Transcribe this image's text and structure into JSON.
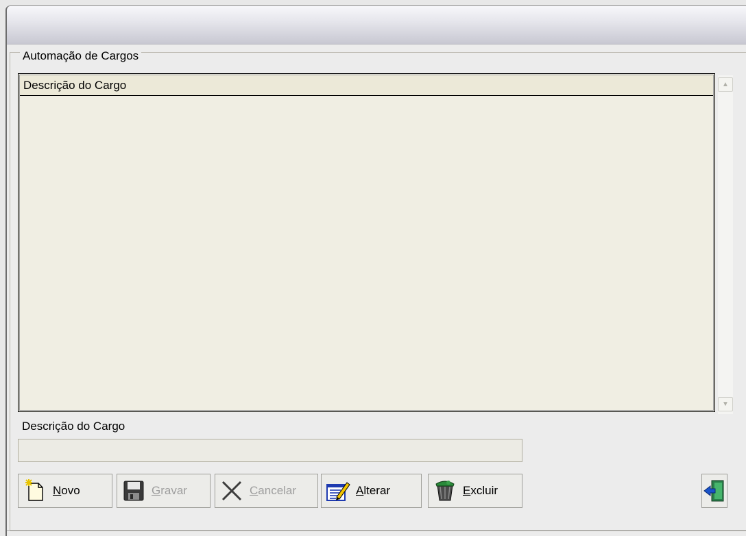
{
  "window": {
    "group_title": "Automação de Cargos"
  },
  "grid": {
    "columns": [
      "Descrição do Cargo"
    ],
    "rows": []
  },
  "form": {
    "description_label": "Descrição do Cargo",
    "description_value": ""
  },
  "toolbar": {
    "buttons": [
      {
        "accel": "N",
        "rest": "ovo",
        "enabled": true,
        "icon": "new-document-icon"
      },
      {
        "accel": "G",
        "rest": "ravar",
        "enabled": false,
        "icon": "floppy-disk-icon"
      },
      {
        "accel": "C",
        "rest": "ancelar",
        "enabled": false,
        "icon": "cancel-x-icon"
      },
      {
        "accel": "A",
        "rest": "lterar",
        "enabled": true,
        "icon": "edit-pencil-icon"
      },
      {
        "accel": "E",
        "rest": "xcluir",
        "enabled": true,
        "icon": "trash-can-icon"
      }
    ],
    "exit_icon": "exit-door-icon"
  },
  "colors": {
    "grid_background": "#f0eee3",
    "window_background": "#ececec",
    "disabled_text": "#9e9e9e"
  }
}
